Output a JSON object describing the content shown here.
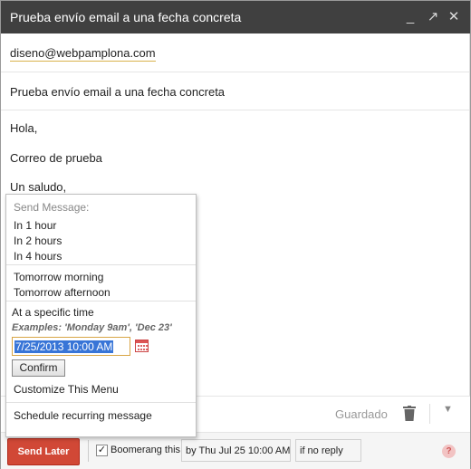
{
  "window": {
    "title": "Prueba envío email a una fecha concreta",
    "controls": {
      "minimize": "_",
      "popout": "↗",
      "close": "✕"
    }
  },
  "compose": {
    "to_chip": "diseno@webpamplona.com",
    "subject": "Prueba envío email a una fecha concreta",
    "body_lines": [
      "Hola,",
      "Correo de prueba",
      "Un saludo,"
    ]
  },
  "toolbar": {
    "saved_label": "Guardado",
    "more_glyph": "▼"
  },
  "send_menu": {
    "header": "Send Message:",
    "quick_options": [
      "In 1 hour",
      "In 2 hours",
      "In 4 hours"
    ],
    "day_options": [
      "Tomorrow morning",
      "Tomorrow afternoon"
    ],
    "specific_label": "At a specific time",
    "examples": "Examples: 'Monday 9am', 'Dec 23'",
    "date_value": "7/25/2013 10:00 AM",
    "confirm_label": "Confirm",
    "customize_label": "Customize This Menu",
    "recurring_label": "Schedule recurring message"
  },
  "bottom_bar": {
    "send_later_label": "Send Later",
    "boomerang_checked": true,
    "boomerang_checkmark": "✓",
    "boomerang_label": "Boomerang this",
    "by_value": "by Thu Jul 25 10:00 AM",
    "condition_value": "if no reply",
    "help_glyph": "?"
  },
  "colors": {
    "titlebar": "#404040",
    "send_button": "#d14836",
    "selection": "#3875d7"
  }
}
